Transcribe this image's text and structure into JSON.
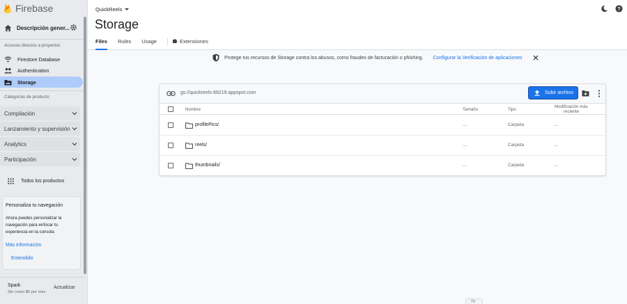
{
  "brand": {
    "name": "Firebase"
  },
  "project_nav": {
    "label": "Descripción gener..."
  },
  "sidebar": {
    "shortcuts_label": "Accesos directos a proyectos",
    "items": [
      {
        "label": "Firestore Database",
        "icon": "firestore-icon"
      },
      {
        "label": "Authentication",
        "icon": "people-icon"
      },
      {
        "label": "Storage",
        "icon": "storage-folder-icon",
        "active": true
      }
    ],
    "categories_label": "Categorías de producto",
    "categories": [
      {
        "label": "Compilación"
      },
      {
        "label": "Lanzamiento y supervisión"
      },
      {
        "label": "Analytics"
      },
      {
        "label": "Participación"
      }
    ],
    "all_products": "Todos los productos",
    "customize": {
      "title": "Personaliza tu navegación",
      "body": "Ahora puedes personalizar la navegación para enfocar tu experiencia en la consola",
      "more_info": "Más información",
      "understood": "Entendido"
    },
    "plan": {
      "name": "Spark",
      "subtitle": "Sin costo $0 por mes",
      "upgrade": "Actualizar"
    }
  },
  "header": {
    "project": "QuickReels",
    "title": "Storage",
    "tabs": [
      {
        "label": "Files",
        "active": true
      },
      {
        "label": "Rules"
      },
      {
        "label": "Usage"
      }
    ],
    "extensions_tab": "Extensiones"
  },
  "notice": {
    "text": "Protege tus recursos de Storage contra los abusos, como fraudes de facturación o phishing.",
    "link": "Configurar la Verificación de aplicaciones"
  },
  "storage": {
    "bucket_path": "gs://quickreels-68219.appspot.com",
    "upload_label": "Subir archivo",
    "columns": {
      "name": "Nombre",
      "size": "Tamaño",
      "type": "Tipo",
      "modified_l1": "Modificación más",
      "modified_l2": "reciente"
    },
    "rows": [
      {
        "name": "profilePics/",
        "size": "—",
        "type": "Carpeta",
        "modified": "—"
      },
      {
        "name": "reels/",
        "size": "—",
        "type": "Carpeta",
        "modified": "—"
      },
      {
        "name": "thumbnails/",
        "size": "—",
        "type": "Carpeta",
        "modified": "—"
      }
    ]
  },
  "bottom_tab": "TV",
  "colors": {
    "accent": "#1a73e8",
    "active_nav": "#aecbfa",
    "sidebar_bg": "#e8eaed"
  }
}
